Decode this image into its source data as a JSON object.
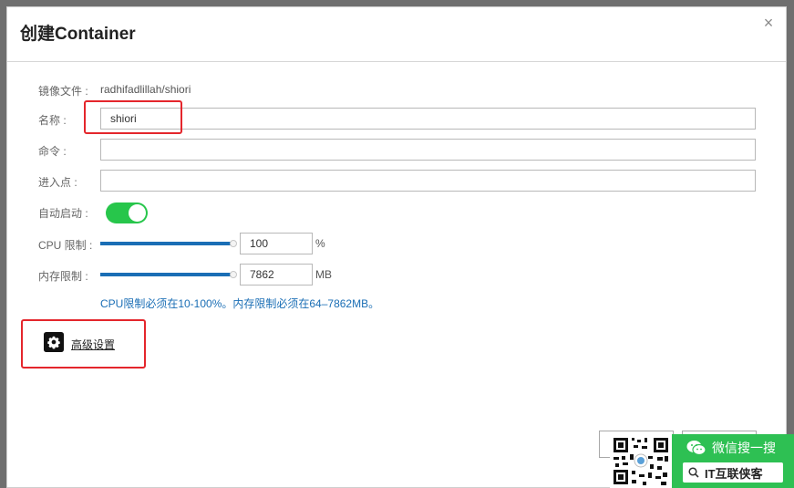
{
  "dialog": {
    "title": "创建Container",
    "close_glyph": "×"
  },
  "form": {
    "image": {
      "label": "镜像文件 :",
      "value": "radhifadlillah/shiori"
    },
    "name": {
      "label": "名称 :",
      "value": "shiori"
    },
    "command": {
      "label": "命令 :",
      "value": ""
    },
    "entrypoint": {
      "label": "进入点 :",
      "value": ""
    },
    "autostart": {
      "label": "自动启动 :",
      "on": true
    },
    "cpu": {
      "label": "CPU 限制 :",
      "value": "100",
      "unit": "%",
      "slider_fraction": 1.0
    },
    "memory": {
      "label": "内存限制 :",
      "value": "7862",
      "unit": "MB",
      "slider_fraction": 1.0
    },
    "hint": "CPU限制必须在10-100%。内存限制必须在64–7862MB。"
  },
  "advanced": {
    "label": "高级设置",
    "icon": "gear-icon"
  },
  "watermark": {
    "wechat_text": "微信搜一搜",
    "search_text": "IT互联侠客"
  },
  "colors": {
    "accent": "#1a6eb5",
    "toggle_on": "#27c64b",
    "highlight": "#e4262c",
    "wechat_green": "#2ec053"
  }
}
